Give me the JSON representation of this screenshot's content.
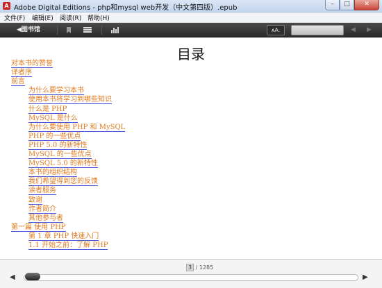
{
  "window": {
    "title": "Adobe Digital Editions - php和mysql web开发（中文第四版）.epub",
    "min": "–",
    "max": "□",
    "close": "✕"
  },
  "menu": [
    "文件(F)",
    "编辑(E)",
    "阅读(R)",
    "帮助(H)"
  ],
  "toolbar": {
    "library_label": "◀图书馆",
    "font_label": "ᴀA.",
    "prev": "◀",
    "next": "▶"
  },
  "page": {
    "title": "目录",
    "toc": [
      {
        "text": "对本书的赞誉",
        "level": 0
      },
      {
        "text": "译者序",
        "level": 0
      },
      {
        "text": "前言",
        "level": 0
      },
      {
        "text": "为什么要学习本书",
        "level": 1
      },
      {
        "text": "使用本书将学习到哪些知识",
        "level": 1
      },
      {
        "text": "什么是 PHP",
        "level": 1
      },
      {
        "text": "MySQL 是什么",
        "level": 1
      },
      {
        "text": "为什么要使用 PHP 和 MySQL",
        "level": 1
      },
      {
        "text": "PHP 的一些优点",
        "level": 1
      },
      {
        "text": "PHP 5.0 的新特性",
        "level": 1
      },
      {
        "text": "MySQL 的一些优点",
        "level": 1
      },
      {
        "text": "MySQL 5.0 的新特性",
        "level": 1
      },
      {
        "text": "本书的组织结构",
        "level": 1
      },
      {
        "text": "我们希望得到您的反馈",
        "level": 1
      },
      {
        "text": "读者服务",
        "level": 1
      },
      {
        "text": "致谢",
        "level": 1
      },
      {
        "text": "作者简介",
        "level": 1
      },
      {
        "text": "其他参与者",
        "level": 1
      },
      {
        "text": "第一篇  使用 PHP",
        "level": 0
      },
      {
        "text": "第 1 章  PHP 快速入门",
        "level": 1
      },
      {
        "text": "1.1  开始之前：了解 PHP",
        "level": 1
      }
    ]
  },
  "footer": {
    "current_page": "3",
    "total_pages": "/ 1285",
    "prev_arrow": "◀",
    "next_arrow": "▶",
    "progress_fraction": 0.0023
  }
}
